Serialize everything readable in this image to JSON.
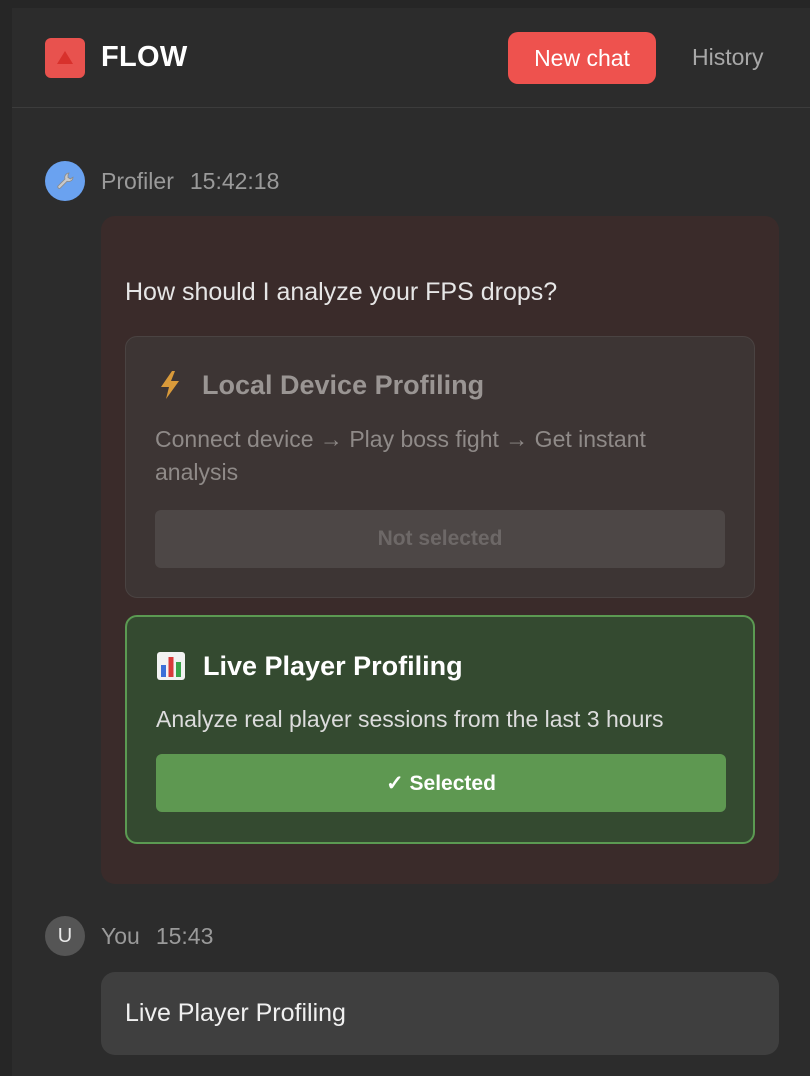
{
  "header": {
    "app_title": "FLOW",
    "new_chat_label": "New chat",
    "history_label": "History",
    "logo_icon": "warning-triangle-icon",
    "accent_color": "#ee524e"
  },
  "messages": [
    {
      "sender": "Profiler",
      "time": "15:42:18",
      "avatar_icon": "wrench-icon",
      "question": "How should I analyze your FPS drops?",
      "options": [
        {
          "icon": "lightning-icon",
          "title": "Local Device Profiling",
          "description": "Connect device → Play boss fight → Get instant analysis",
          "button_label": "Not selected",
          "state": "not-selected"
        },
        {
          "icon": "bar-chart-icon",
          "title": "Live Player Profiling",
          "description": "Analyze real player sessions from the last 3 hours",
          "button_label": "✓ Selected",
          "state": "selected",
          "state_color": "#5e9851"
        }
      ]
    },
    {
      "sender": "You",
      "time": "15:43",
      "avatar_letter": "U",
      "text": "Live Player Profiling"
    }
  ]
}
